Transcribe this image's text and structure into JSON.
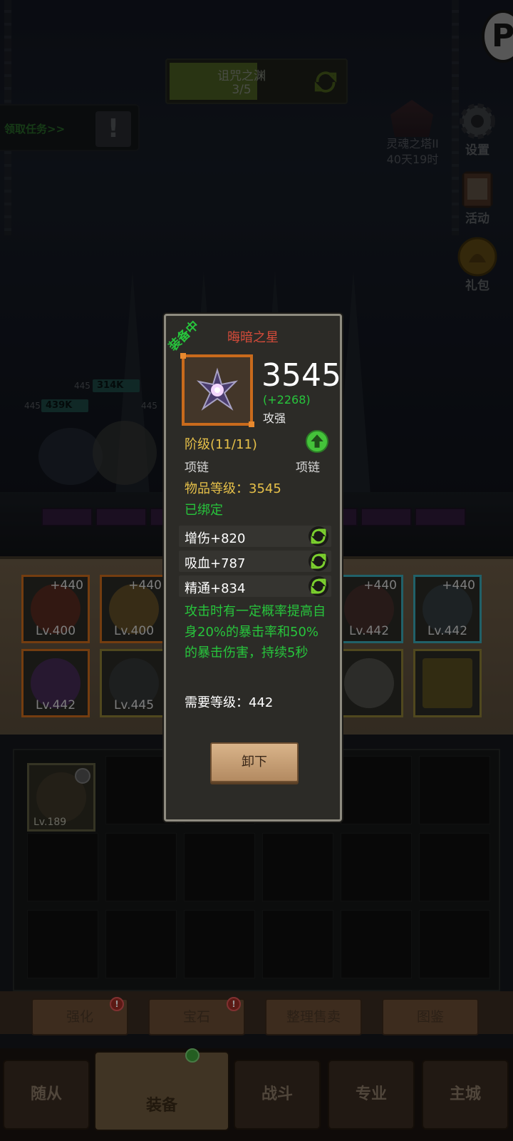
{
  "quest": {
    "title": "诅咒之渊",
    "progress": "3/5",
    "progress_fraction": 0.6
  },
  "task_tab": {
    "label": "领取任务>>",
    "alert": "!"
  },
  "tower": {
    "name": "灵魂之塔II",
    "time_left": "40天19时"
  },
  "side_menu": [
    {
      "label": "设置",
      "icon": "gear-icon"
    },
    {
      "label": "活动",
      "icon": "scroll-icon"
    },
    {
      "label": "礼包",
      "icon": "gift-pouch-icon"
    }
  ],
  "hp_bars": [
    {
      "level": "445",
      "value": "314K"
    },
    {
      "level": "445",
      "value": "439K"
    },
    {
      "level": "445",
      "value": ""
    }
  ],
  "equipment_slots": [
    {
      "plus": "+440",
      "level": "Lv.400",
      "rarity_color": "#c86a1c",
      "icon": "pirate-hat-icon"
    },
    {
      "plus": "+440",
      "level": "Lv.400",
      "rarity_color": "#c86a1c",
      "icon": "armor-icon"
    },
    {
      "plus": "+440",
      "level": "Lv.442",
      "rarity_color": "#3aa7b5",
      "icon": "axe-icon"
    },
    {
      "plus": "+440",
      "level": "Lv.442",
      "rarity_color": "#3aa7b5",
      "icon": "dagger-icon"
    },
    {
      "plus": "",
      "level": "Lv.442",
      "rarity_color": "#c86a1c",
      "icon": "dark-star-icon"
    },
    {
      "plus": "",
      "level": "Lv.445",
      "rarity_color": "#8a7d35",
      "icon": "ring-icon"
    },
    {
      "plus": "",
      "level": "",
      "rarity_color": "#8a7d35",
      "icon": "stone-icon"
    },
    {
      "plus": "",
      "level": "",
      "rarity_color": "#8a7d35",
      "icon": "shield-icon"
    }
  ],
  "inventory": {
    "items": [
      {
        "level": "Lv.189",
        "icon": "axe-icon",
        "locked": true
      }
    ]
  },
  "tools": [
    {
      "label": "强化",
      "alert": "!"
    },
    {
      "label": "宝石",
      "alert": "!"
    },
    {
      "label": "整理售卖",
      "alert": ""
    },
    {
      "label": "图鉴",
      "alert": ""
    }
  ],
  "nav": [
    {
      "label": "随从"
    },
    {
      "label": "装备"
    },
    {
      "label": "战斗"
    },
    {
      "label": "专业"
    },
    {
      "label": "主城"
    }
  ],
  "tooltip": {
    "equipped_tag": "装备中",
    "name": "晦暗之星",
    "name_color": "#d44b3a",
    "icon": "dark-star-icon",
    "power": "3545",
    "power_delta": "(+2268)",
    "power_stat": "攻强",
    "tier": "阶级(11/11)",
    "slot_type_left": "项链",
    "slot_type_right": "项链",
    "item_level": "物品等级：3545",
    "bound": "已绑定",
    "stats": [
      "增伤+820",
      "吸血+787",
      "精通+834"
    ],
    "effect": "攻击时有一定概率提高自身20%的暴击率和50%的暴击伤害，持续5秒",
    "required_level": "需要等级：442",
    "unequip_label": "卸下"
  }
}
